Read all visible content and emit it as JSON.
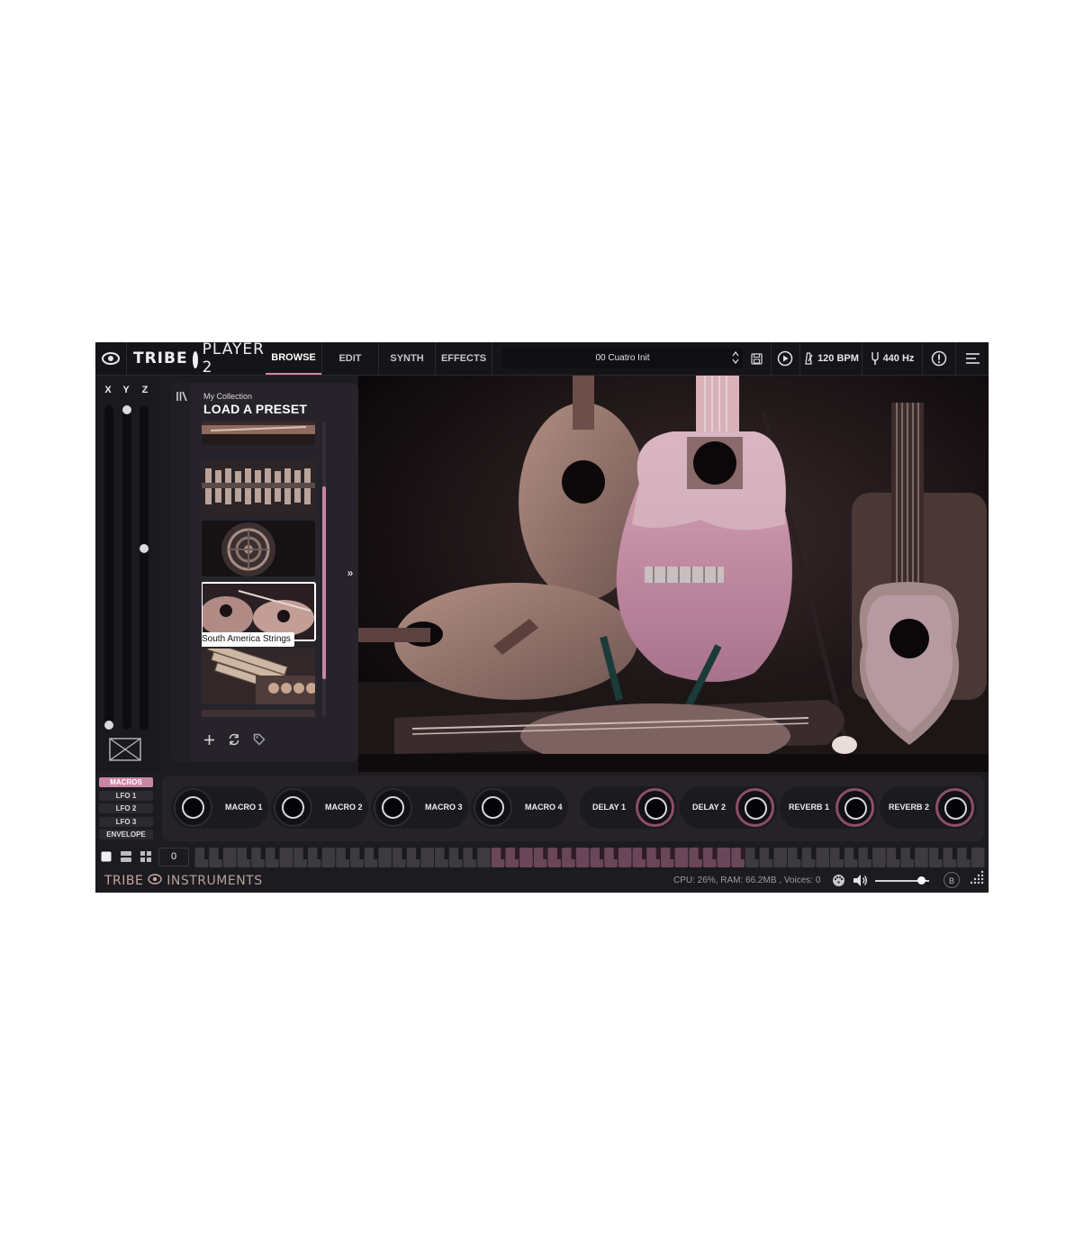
{
  "app": {
    "brand_part1": "TRIBE",
    "brand_part2": "PLAYER 2"
  },
  "tabs": [
    {
      "label": "BROWSE",
      "active": true
    },
    {
      "label": "EDIT"
    },
    {
      "label": "SYNTH"
    },
    {
      "label": "EFFECTS"
    }
  ],
  "preset": {
    "name": "00 Cuatro Init"
  },
  "topbar": {
    "bpm": "120 BPM",
    "tuning": "440 Hz"
  },
  "xyz": {
    "labels": [
      "X",
      "Y",
      "Z"
    ],
    "levels": [
      0.0,
      1.0,
      0.56
    ]
  },
  "browser": {
    "collection": "My Collection",
    "title": "LOAD A PRESET",
    "selected_label": "South America Strings"
  },
  "modes": [
    {
      "label": "MACROS",
      "active": true
    },
    {
      "label": "LFO 1"
    },
    {
      "label": "LFO 2"
    },
    {
      "label": "LFO 3"
    },
    {
      "label": "ENVELOPE"
    }
  ],
  "controls": [
    {
      "label": "MACRO 1"
    },
    {
      "label": "MACRO 2"
    },
    {
      "label": "MACRO 3"
    },
    {
      "label": "MACRO 4"
    },
    {
      "label": "DELAY 1"
    },
    {
      "label": "DELAY 2"
    },
    {
      "label": "REVERB 1"
    },
    {
      "label": "REVERB 2"
    }
  ],
  "keyboard": {
    "octave": "0"
  },
  "footer": {
    "brand_part1": "TRIBE",
    "brand_part2": "INSTRUMENTS",
    "stats": "CPU: 26%, RAM: 66.2MB , Voices: 0",
    "volume": 0.85,
    "b_label": "B"
  },
  "colors": {
    "accent": "#c985a5",
    "background": "#1c1b1f",
    "topbar": "#151417"
  }
}
